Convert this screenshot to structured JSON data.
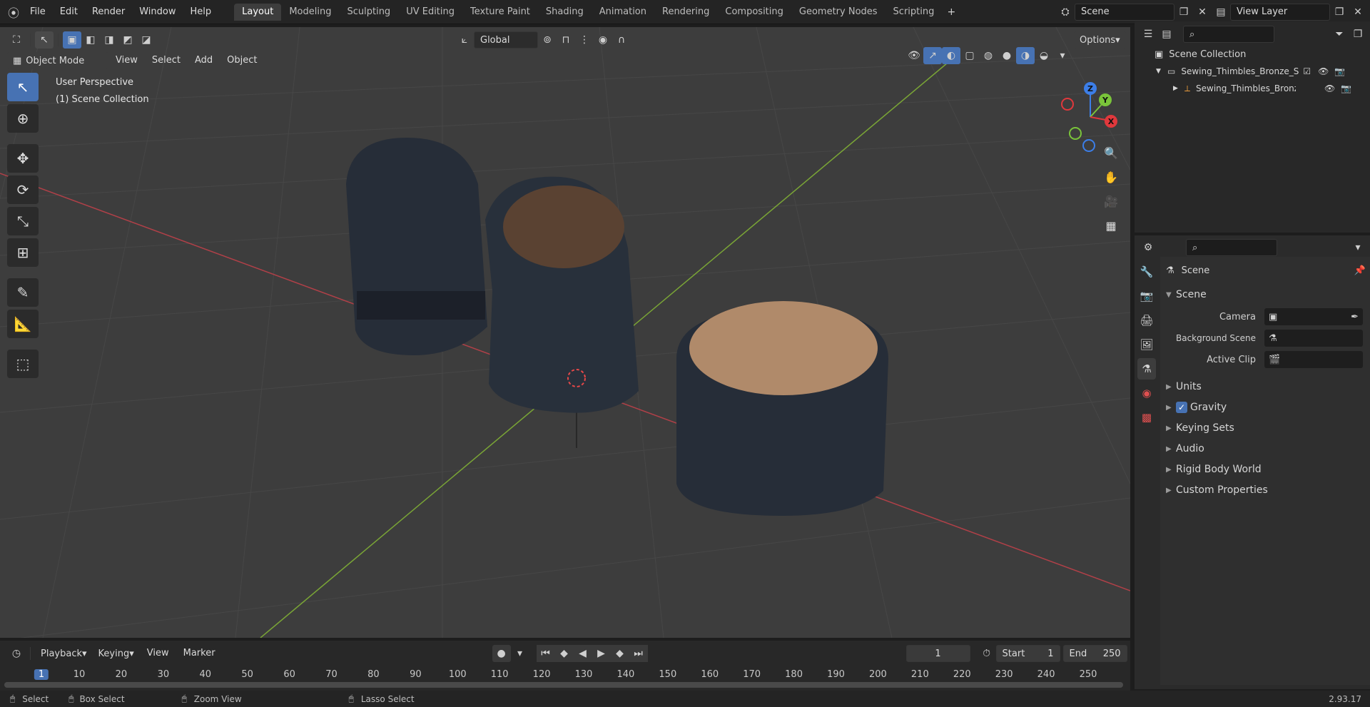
{
  "topbar": {
    "menus": [
      "File",
      "Edit",
      "Render",
      "Window",
      "Help"
    ],
    "workspaces": [
      "Layout",
      "Modeling",
      "Sculpting",
      "UV Editing",
      "Texture Paint",
      "Shading",
      "Animation",
      "Rendering",
      "Compositing",
      "Geometry Nodes",
      "Scripting"
    ],
    "active_workspace": "Layout",
    "add_tab": "+",
    "scene_name": "Scene",
    "view_layer": "View Layer"
  },
  "viewport_header": {
    "transform_orientation": "Global",
    "options_label": "Options",
    "mode": "Object Mode",
    "menus": [
      "View",
      "Select",
      "Add",
      "Object"
    ]
  },
  "viewport": {
    "perspective": "User Perspective",
    "collection": "(1) Scene Collection",
    "gizmo_axes": [
      "Z",
      "Y",
      "X"
    ],
    "colors": {
      "x_axis": "#e0383c",
      "y_axis": "#7ac43a",
      "z_axis": "#3c7ee8",
      "background": "#3d3d3d",
      "grid": "#4a4a4a"
    }
  },
  "outliner": {
    "root": "Scene Collection",
    "collection": "Sewing_Thimbles_Bronze_Set",
    "object": "Sewing_Thimbles_Bronze"
  },
  "properties": {
    "header": "Scene",
    "panel_title": "Scene",
    "camera_label": "Camera",
    "background_scene_label": "Background Scene",
    "active_clip_label": "Active Clip",
    "subpanels": [
      "Units",
      "Gravity",
      "Keying Sets",
      "Audio",
      "Rigid Body World",
      "Custom Properties"
    ],
    "gravity_checked": true
  },
  "timeline": {
    "menus": [
      "Playback",
      "Keying",
      "View",
      "Marker"
    ],
    "current_frame": "1",
    "start_label": "Start",
    "start": "1",
    "end_label": "End",
    "end": "250",
    "ticks": [
      "1",
      "10",
      "20",
      "30",
      "40",
      "50",
      "60",
      "70",
      "80",
      "90",
      "100",
      "110",
      "120",
      "130",
      "140",
      "150",
      "160",
      "170",
      "180",
      "190",
      "200",
      "210",
      "220",
      "230",
      "240",
      "250"
    ]
  },
  "statusbar": {
    "select": "Select",
    "box_select": "Box Select",
    "zoom_view": "Zoom View",
    "lasso_select": "Lasso Select",
    "version": "2.93.17"
  }
}
